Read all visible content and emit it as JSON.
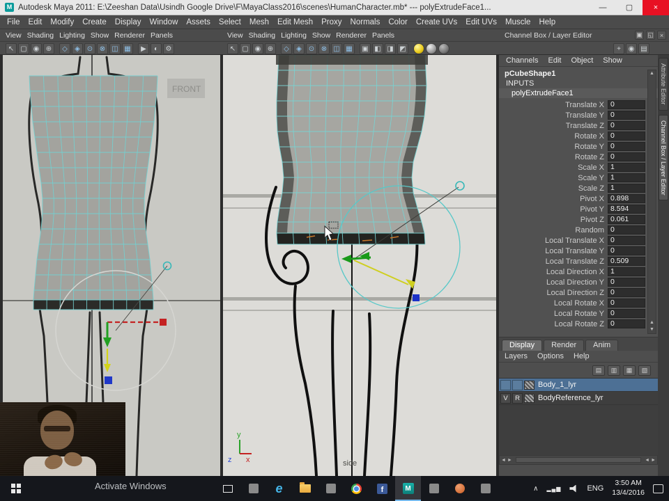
{
  "window": {
    "title": "Autodesk Maya 2011: E:\\Zeeshan Data\\Usindh Google Drive\\F\\MayaClass2016\\scenes\\HumanCharacter.mb*   ---   polyExtrudeFace1...",
    "minimize": "—",
    "maximize": "▢",
    "close": "×"
  },
  "menu_bar": {
    "items": [
      "File",
      "Edit",
      "Modify",
      "Create",
      "Display",
      "Window",
      "Assets",
      "Select",
      "Mesh",
      "Edit Mesh",
      "Proxy",
      "Normals",
      "Color",
      "Create UVs",
      "Edit UVs",
      "Muscle",
      "Help"
    ]
  },
  "viewport_menu": {
    "items": [
      "View",
      "Shading",
      "Lighting",
      "Show",
      "Renderer",
      "Panels"
    ]
  },
  "front_viewport": {
    "image_label": "FRONT"
  },
  "side_viewport": {
    "view_label": "side",
    "axis_x": "x",
    "axis_y": "y",
    "axis_z": "z"
  },
  "toolbar": {
    "left": [
      {
        "g": "↖",
        "name": "select-tool-icon"
      },
      {
        "g": "▢",
        "name": "lasso-select-icon"
      },
      {
        "g": "◉",
        "name": "paint-select-icon"
      },
      {
        "g": "⊕",
        "name": "move-tool-icon"
      },
      {
        "cls": "sep"
      },
      {
        "g": "◇",
        "cls": "blue",
        "name": "snap-grid-icon"
      },
      {
        "g": "◈",
        "cls": "blue",
        "name": "snap-curve-icon"
      },
      {
        "g": "⊙",
        "cls": "blue",
        "name": "snap-point-icon"
      },
      {
        "g": "⊗",
        "cls": "blue",
        "name": "snap-plane-icon"
      },
      {
        "g": "◫",
        "cls": "blue",
        "name": "make-live-icon"
      },
      {
        "g": "▦",
        "cls": "blue",
        "name": "construction-history-icon"
      },
      {
        "cls": "sep"
      },
      {
        "g": "▶",
        "name": "render-icon"
      },
      {
        "g": "◐",
        "name": "ipr-render-icon"
      },
      {
        "g": "⚙",
        "name": "render-settings-icon"
      }
    ],
    "center": [
      {
        "g": "↖",
        "name": "select-tool-icon"
      },
      {
        "g": "▢",
        "name": "lasso-select-icon"
      },
      {
        "g": "◉",
        "name": "paint-select-icon"
      },
      {
        "g": "⊕",
        "name": "move-tool-icon"
      },
      {
        "cls": "sep"
      },
      {
        "g": "◇",
        "cls": "blue",
        "name": "snap-grid-icon"
      },
      {
        "g": "◈",
        "cls": "blue",
        "name": "snap-curve-icon"
      },
      {
        "g": "⊙",
        "cls": "blue",
        "name": "snap-point-icon"
      },
      {
        "g": "⊗",
        "cls": "blue",
        "name": "snap-plane-icon"
      },
      {
        "g": "◫",
        "cls": "blue",
        "name": "make-live-icon"
      },
      {
        "g": "▦",
        "cls": "blue",
        "name": "construction-history-icon"
      },
      {
        "cls": "sep"
      },
      {
        "g": "▣",
        "name": "isolate-select-icon"
      },
      {
        "g": "◧",
        "name": "wireframe-display-icon"
      },
      {
        "g": "◨",
        "name": "shaded-display-icon"
      },
      {
        "g": "◩",
        "name": "textured-display-icon"
      },
      {
        "cls": "sep"
      },
      {
        "g": "●",
        "cls": "ball-y",
        "name": "default-lighting-icon"
      },
      {
        "g": "●",
        "cls": "ball-g",
        "name": "all-lights-icon"
      },
      {
        "g": "●",
        "cls": "ball-g2",
        "name": "shadows-icon"
      }
    ],
    "right": [
      {
        "g": "+",
        "name": "add-attribute-icon"
      },
      {
        "g": "◉",
        "name": "show-manipulator-icon"
      },
      {
        "g": "▤",
        "name": "channel-options-icon"
      }
    ]
  },
  "channel_box": {
    "header": "Channel Box / Layer Editor",
    "header_icons": [
      {
        "g": "▣",
        "name": "dock-panel-icon"
      },
      {
        "g": "◱",
        "name": "float-panel-icon"
      },
      {
        "g": "×",
        "name": "close-panel-icon"
      }
    ],
    "menus": [
      "Channels",
      "Edit",
      "Object",
      "Show"
    ],
    "shape_node": "pCubeShape1",
    "section_label": "INPUTS",
    "input_node": "polyExtrudeFace1",
    "attributes": [
      {
        "label": "Translate X",
        "value": "0"
      },
      {
        "label": "Translate Y",
        "value": "0"
      },
      {
        "label": "Translate Z",
        "value": "0"
      },
      {
        "label": "Rotate X",
        "value": "0"
      },
      {
        "label": "Rotate Y",
        "value": "0"
      },
      {
        "label": "Rotate Z",
        "value": "0"
      },
      {
        "label": "Scale X",
        "value": "1"
      },
      {
        "label": "Scale Y",
        "value": "1"
      },
      {
        "label": "Scale Z",
        "value": "1"
      },
      {
        "label": "Pivot X",
        "value": "0.898"
      },
      {
        "label": "Pivot Y",
        "value": "8.594"
      },
      {
        "label": "Pivot Z",
        "value": "0.061"
      },
      {
        "label": "Random",
        "value": "0"
      },
      {
        "label": "Local Translate X",
        "value": "0"
      },
      {
        "label": "Local Translate Y",
        "value": "0"
      },
      {
        "label": "Local Translate Z",
        "value": "0.509"
      },
      {
        "label": "Local Direction X",
        "value": "1"
      },
      {
        "label": "Local Direction Y",
        "value": "0"
      },
      {
        "label": "Local Direction Z",
        "value": "0"
      },
      {
        "label": "Local Rotate X",
        "value": "0"
      },
      {
        "label": "Local Rotate Y",
        "value": "0"
      },
      {
        "label": "Local Rotate Z",
        "value": "0"
      }
    ]
  },
  "layer_editor": {
    "tabs": [
      {
        "label": "Display",
        "cls": "active"
      },
      {
        "label": "Render"
      },
      {
        "label": "Anim"
      }
    ],
    "menus": [
      "Layers",
      "Options",
      "Help"
    ],
    "toolbar_icons": [
      {
        "g": "▤",
        "name": "empty-layer-icon"
      },
      {
        "g": "▥",
        "name": "layer-from-selected-icon"
      },
      {
        "g": "▦",
        "name": "move-layer-up-icon"
      },
      {
        "g": "▧",
        "name": "move-layer-down-icon"
      }
    ],
    "layers": [
      {
        "v": "",
        "r": "",
        "name": "Body_1_lyr",
        "cls": "selected"
      },
      {
        "v": "V",
        "r": "R",
        "name": "BodyReference_lyr"
      }
    ]
  },
  "side_tabs": [
    {
      "label": "Attribute Editor"
    },
    {
      "label": "Channel Box / Layer Editor",
      "cls": "active"
    }
  ],
  "taskbar": {
    "apps": [
      {
        "g": "",
        "cls": "ic-taskview"
      },
      {
        "g": "",
        "cls": "ic-gray"
      },
      {
        "g": "e",
        "cls": "ic-edge"
      },
      {
        "g": "",
        "cls": "ic-folder"
      },
      {
        "g": "",
        "cls": "ic-gray"
      },
      {
        "g": "",
        "cls": "ic-chrome"
      },
      {
        "g": "f",
        "cls": "ic-facebook"
      },
      {
        "g": "M",
        "cls": "ic-maya active"
      },
      {
        "g": "",
        "cls": "ic-gray"
      },
      {
        "g": "",
        "cls": "ic-orange"
      },
      {
        "g": "",
        "cls": "ic-gray"
      }
    ],
    "tray": [
      {
        "g": "∧"
      },
      {
        "g": "▂▄▆",
        "cls": "net"
      },
      {
        "g": "",
        "cls": "vol"
      }
    ],
    "lang": "ENG",
    "time": "3:50 AM",
    "date": "13/4/2016"
  },
  "watermark": "Activate Windows"
}
